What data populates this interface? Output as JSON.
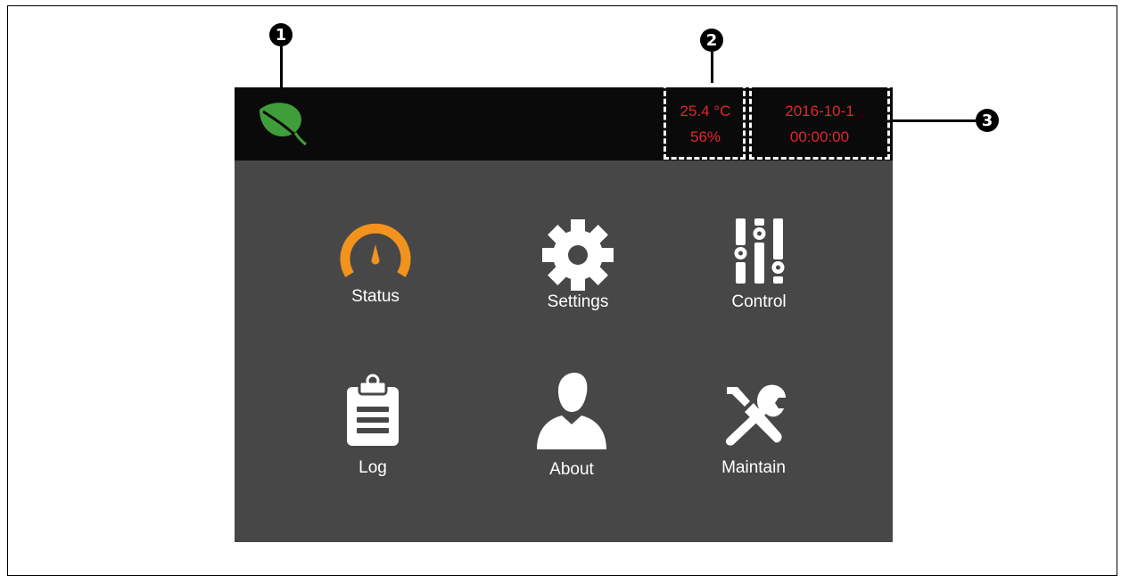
{
  "callouts": [
    "1",
    "2",
    "3"
  ],
  "header": {
    "temperature": "25.4 °C",
    "humidity": "56%",
    "date": "2016-10-1",
    "time": "00:00:00"
  },
  "menu": [
    {
      "label": "Status",
      "icon": "gauge-icon"
    },
    {
      "label": "Settings",
      "icon": "gear-icon"
    },
    {
      "label": "Control",
      "icon": "sliders-icon"
    },
    {
      "label": "Log",
      "icon": "clipboard-icon"
    },
    {
      "label": "About",
      "icon": "user-icon"
    },
    {
      "label": "Maintain",
      "icon": "tools-icon"
    }
  ],
  "colors": {
    "accent_orange": "#f2931e",
    "readout_red": "#e4262b",
    "leaf_green": "#3f9e3a",
    "panel_gray": "#474747",
    "topbar_black": "#0a0a0a"
  }
}
